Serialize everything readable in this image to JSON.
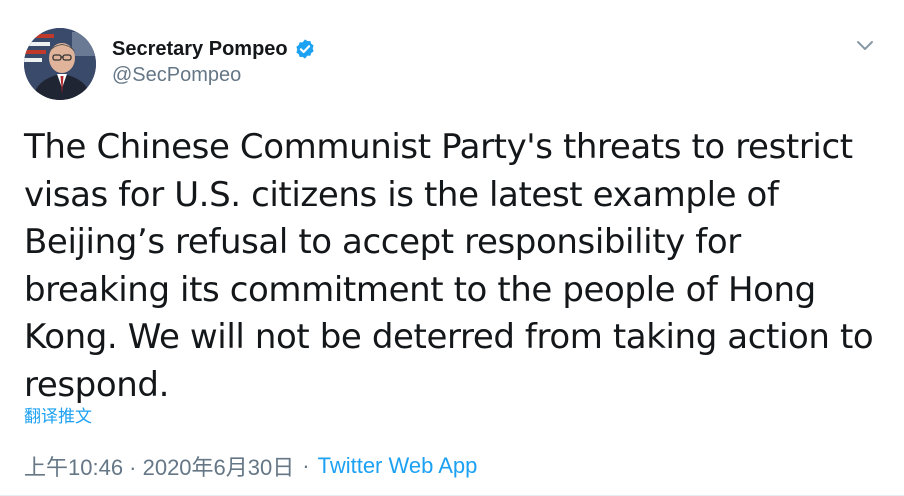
{
  "author": {
    "display_name": "Secretary Pompeo",
    "handle": "@SecPompeo",
    "verified": true,
    "avatar_icon": "avatar-portrait"
  },
  "menu": {
    "icon": "chevron-down-icon"
  },
  "tweet": {
    "text": "The Chinese Communist Party's threats to restrict visas for U.S. citizens is the latest example of Beijing’s refusal to accept responsibility for breaking its commitment to the people of Hong Kong. We will not be deterred from taking action to respond."
  },
  "translate": {
    "label": "翻译推文"
  },
  "meta": {
    "timestamp": "上午10:46 · 2020年6月30日",
    "separator": "·",
    "source": "Twitter Web App"
  },
  "colors": {
    "link": "#1da1f2",
    "secondary_text": "#657786",
    "primary_text": "#14171a",
    "verified_badge": "#1da1f2"
  }
}
